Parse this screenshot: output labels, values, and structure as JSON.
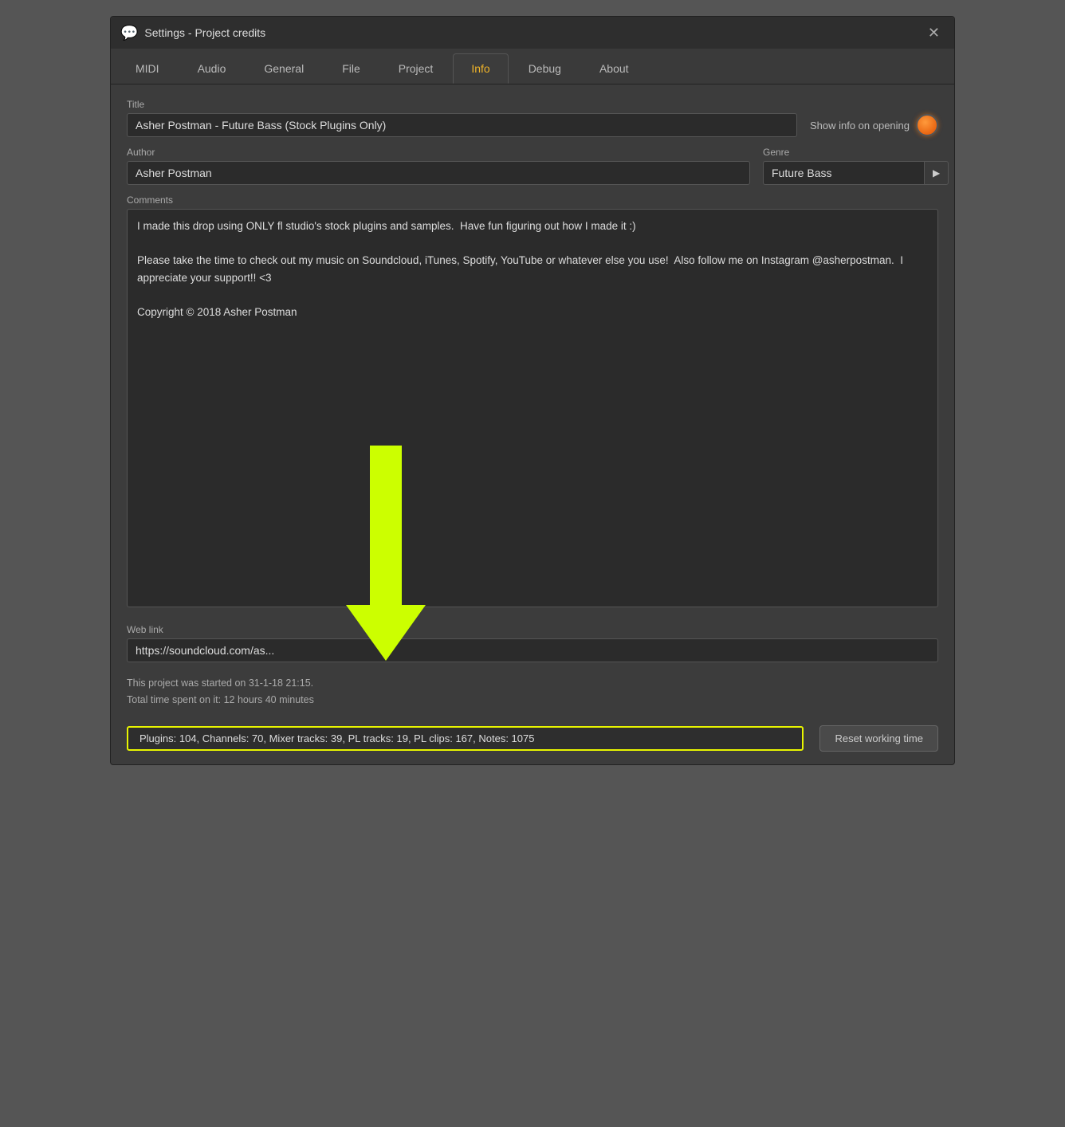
{
  "window": {
    "title": "Settings - Project credits",
    "icon": "💬"
  },
  "tabs": [
    {
      "id": "midi",
      "label": "MIDI",
      "active": false
    },
    {
      "id": "audio",
      "label": "Audio",
      "active": false
    },
    {
      "id": "general",
      "label": "General",
      "active": false
    },
    {
      "id": "file",
      "label": "File",
      "active": false
    },
    {
      "id": "project",
      "label": "Project",
      "active": false
    },
    {
      "id": "info",
      "label": "Info",
      "active": true
    },
    {
      "id": "debug",
      "label": "Debug",
      "active": false
    },
    {
      "id": "about",
      "label": "About",
      "active": false
    }
  ],
  "fields": {
    "title_label": "Title",
    "title_value": "Asher Postman - Future Bass (Stock Plugins Only)",
    "show_info_label": "Show info on opening",
    "author_label": "Author",
    "author_value": "Asher Postman",
    "genre_label": "Genre",
    "genre_value": "Future Bass",
    "comments_label": "Comments",
    "comments_value": "I made this drop using ONLY fl studio's stock plugins and samples.  Have fun figuring out how I made it :)\n\nPlease take the time to check out my music on Soundcloud, iTunes, Spotify, YouTube or whatever else you use!  Also follow me on Instagram @asherpostman.  I appreciate your support!! <3\n\nCopyright © 2018 Asher Postman",
    "weblink_label": "Web link",
    "weblink_value": "https://soundcloud.com/as..."
  },
  "bottom": {
    "project_start": "This project was started on 31-1-18 21:15.",
    "total_time": "Total time spent on it: 12 hours 40 minutes",
    "stats": "Plugins: 104, Channels: 70, Mixer tracks: 39, PL tracks: 19, PL clips: 167, Notes: 1075",
    "reset_btn_label": "Reset working time"
  },
  "close_btn_label": "✕"
}
